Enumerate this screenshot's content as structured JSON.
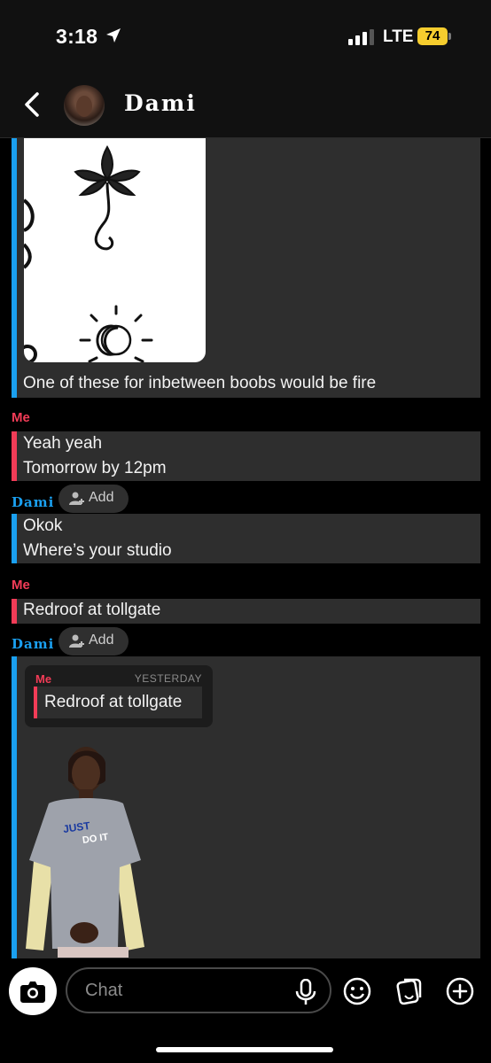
{
  "status_bar": {
    "time": "3:18",
    "network": "LTE",
    "battery": "74"
  },
  "header": {
    "contact_name": "Dami"
  },
  "messages": {
    "caption": "One of these for inbetween boobs would be fire",
    "me_label_1": "Me",
    "me_msg_1_line1": "Yeah yeah",
    "me_msg_1_line2": "Tomorrow by 12pm",
    "dami_label_1": "Dami",
    "add_label": "Add",
    "dami_msg_1_line1": "Okok",
    "dami_msg_1_line2": "Where’s your studio",
    "me_label_2": "Me",
    "me_msg_2": "Redroof at tollgate",
    "dami_label_2": "Dami",
    "quote": {
      "sender": "Me",
      "time": "YESTERDAY",
      "text": "Redroof at tollgate"
    },
    "shirt_text_1": "JUST",
    "shirt_text_2": "DO IT"
  },
  "input": {
    "placeholder": "Chat"
  },
  "colors": {
    "me": "#f23c57",
    "dami": "#1aa0f0",
    "bubble": "#2e2e2e",
    "battery": "#f6cd2e"
  },
  "icons": [
    "location-arrow-icon",
    "signal-icon",
    "chevron-left-icon",
    "user-plus-icon",
    "camera-icon",
    "microphone-icon",
    "smiley-icon",
    "sticker-icon",
    "plus-icon"
  ]
}
